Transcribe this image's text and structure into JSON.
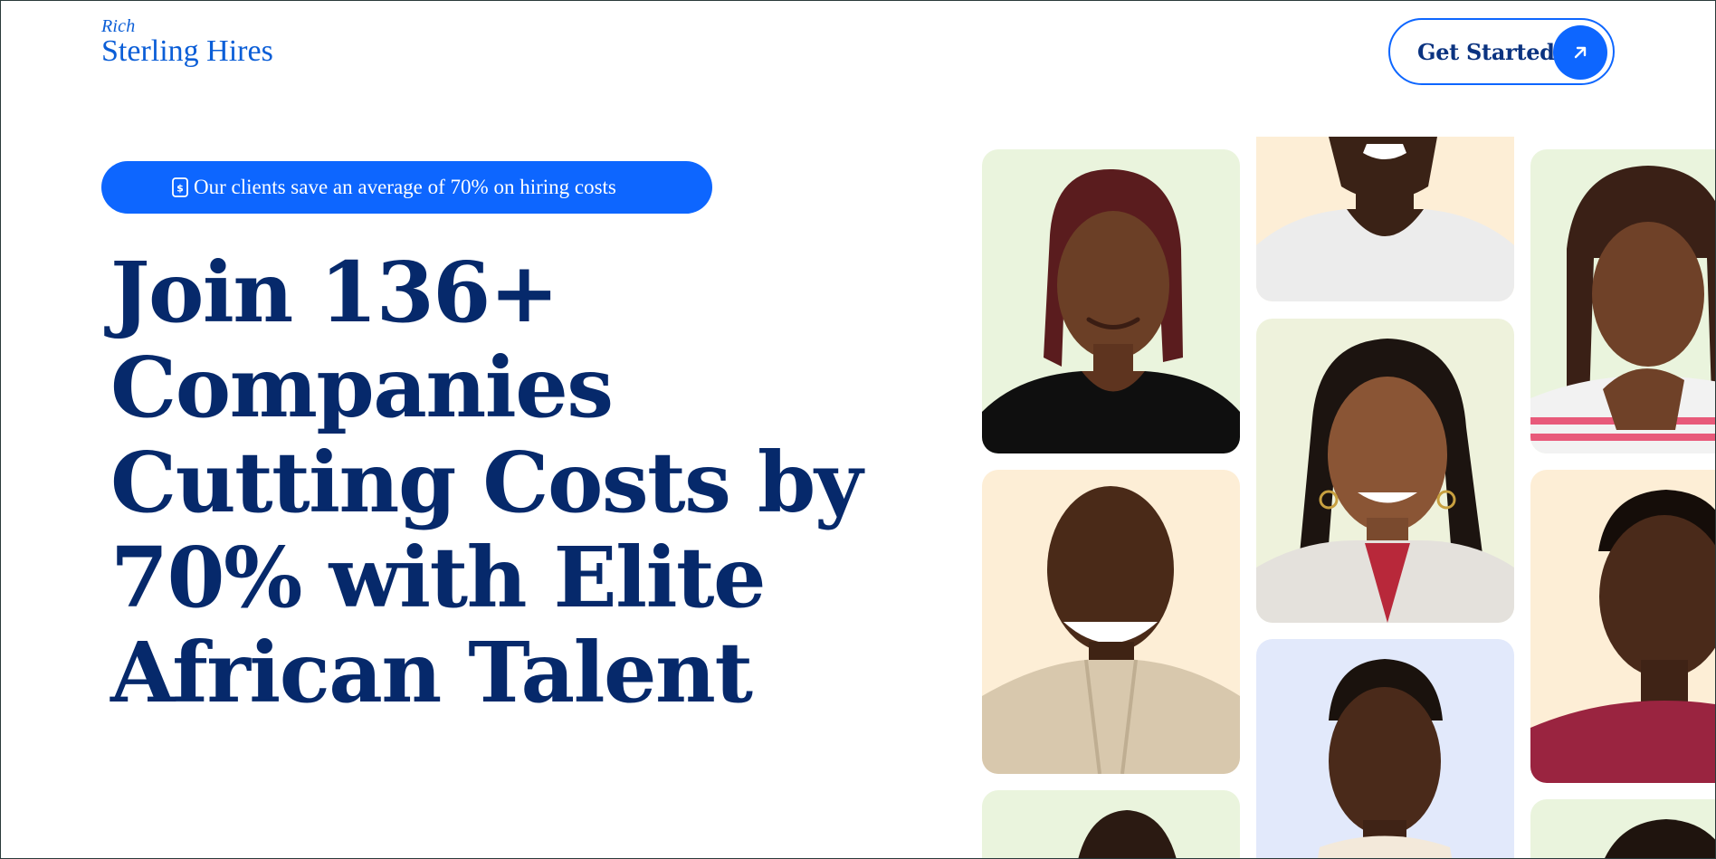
{
  "logo": {
    "top_line": "Rich",
    "name": "Sterling Hires"
  },
  "nav": {
    "cta_label": "Get Started"
  },
  "hero": {
    "badge_text": "Our clients save an average of 70% on hiring costs",
    "headline": "Join 136+ Companies Cutting Costs by 70% with Elite African Talent"
  },
  "colors": {
    "brand_blue": "#0d66ff",
    "headline_navy": "#06296b",
    "tile_green": "#eaf4dd",
    "tile_cream": "#fdeed6",
    "tile_lavender": "#e2e9fb"
  },
  "gallery": {
    "tiles": [
      {
        "bg": "tile_green"
      },
      {
        "bg": "tile_cream"
      },
      {
        "bg": "tile_green"
      },
      {
        "bg": "tile_cream"
      },
      {
        "bg": "tile_green"
      },
      {
        "bg": "tile_green"
      },
      {
        "bg": "tile_cream"
      },
      {
        "bg": "tile_lavender"
      },
      {
        "bg": "tile_green"
      }
    ]
  }
}
